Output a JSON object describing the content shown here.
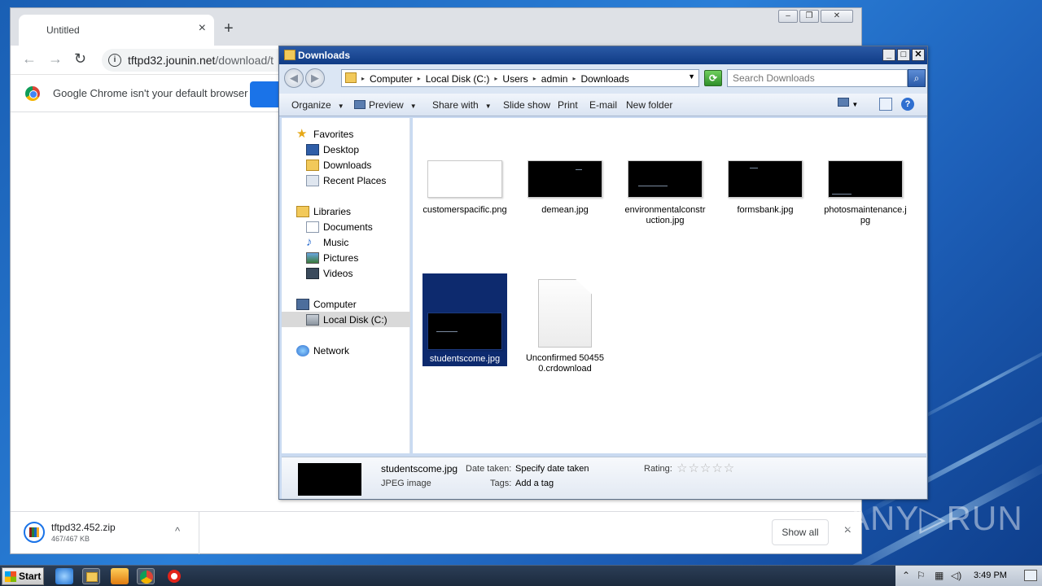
{
  "chrome": {
    "tab_title": "Untitled",
    "tab_close": "×",
    "new_tab": "+",
    "url_host": "tftpd32.jounin.net",
    "url_path": "/download/t",
    "infobar_message": "Google Chrome isn't your default browser",
    "download": {
      "filename": "tftpd32.452.zip",
      "size": "467/467 KB",
      "caret": "^"
    },
    "show_all": "Show all",
    "close_downloads": "×"
  },
  "explorer": {
    "title": "Downloads",
    "breadcrumb": [
      "Computer",
      "Local Disk (C:)",
      "Users",
      "admin",
      "Downloads"
    ],
    "search_placeholder": "Search Downloads",
    "commands": {
      "organize": "Organize",
      "preview": "Preview",
      "share_with": "Share with",
      "slide_show": "Slide show",
      "print": "Print",
      "email": "E-mail",
      "new_folder": "New folder"
    },
    "nav": {
      "favorites": "Favorites",
      "desktop": "Desktop",
      "downloads": "Downloads",
      "recent_places": "Recent Places",
      "libraries": "Libraries",
      "documents": "Documents",
      "music": "Music",
      "pictures": "Pictures",
      "videos": "Videos",
      "computer": "Computer",
      "local_disk": "Local Disk (C:)",
      "network": "Network"
    },
    "files": [
      {
        "name": "customerspacific.png"
      },
      {
        "name": "demean.jpg"
      },
      {
        "name": "environmentalconstruction.jpg"
      },
      {
        "name": "formsbank.jpg"
      },
      {
        "name": "photosmaintenance.jpg"
      },
      {
        "name": "studentscome.jpg"
      },
      {
        "name": "Unconfirmed 504550.crdownload"
      }
    ],
    "details": {
      "filename": "studentscome.jpg",
      "type": "JPEG image",
      "date_taken_label": "Date taken:",
      "date_taken_value": "Specify date taken",
      "tags_label": "Tags:",
      "tags_value": "Add a tag",
      "rating_label": "Rating:",
      "rating_stars": "☆☆☆☆☆"
    }
  },
  "taskbar": {
    "start": "Start",
    "clock": "3:49 PM"
  },
  "watermark": "ANY▷RUN"
}
